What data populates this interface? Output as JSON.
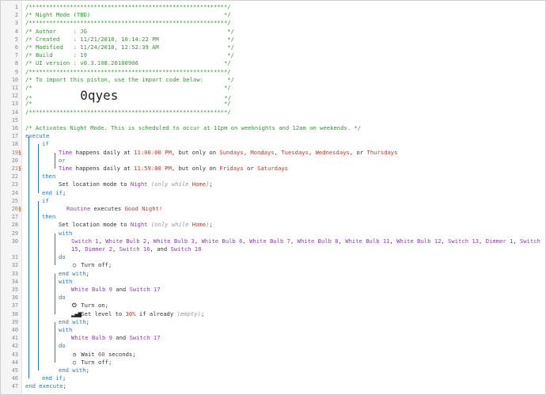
{
  "lines": [
    {
      "n": "1",
      "flag": "",
      "indent": 31,
      "parts": [
        {
          "c": "c",
          "t": "/**********************************************************/"
        }
      ]
    },
    {
      "n": "2",
      "flag": "",
      "indent": 31,
      "parts": [
        {
          "c": "c",
          "t": "/* Night Mode (TBD)                                       */"
        }
      ]
    },
    {
      "n": "3",
      "flag": "",
      "indent": 31,
      "parts": [
        {
          "c": "c",
          "t": "/**********************************************************/"
        }
      ]
    },
    {
      "n": "4",
      "flag": "",
      "indent": 31,
      "parts": [
        {
          "c": "c",
          "t": "/* Author     : JG                                         */"
        }
      ]
    },
    {
      "n": "5",
      "flag": "",
      "indent": 31,
      "parts": [
        {
          "c": "c",
          "t": "/* Created    : 11/21/2018, 10:14:22 PM                    */"
        }
      ]
    },
    {
      "n": "6",
      "flag": "",
      "indent": 31,
      "parts": [
        {
          "c": "c",
          "t": "/* Modified   : 11/24/2018, 12:52:39 AM                    */"
        }
      ]
    },
    {
      "n": "7",
      "flag": "",
      "indent": 31,
      "parts": [
        {
          "c": "c",
          "t": "/* Build      : 19                                         */"
        }
      ]
    },
    {
      "n": "8",
      "flag": "",
      "indent": 31,
      "parts": [
        {
          "c": "c",
          "t": "/* UI version : v0.3.108.20180906                         */"
        }
      ]
    },
    {
      "n": "9",
      "flag": "",
      "indent": 31,
      "parts": [
        {
          "c": "c",
          "t": "/**********************************************************/"
        }
      ]
    },
    {
      "n": "10",
      "flag": "",
      "indent": 31,
      "parts": [
        {
          "c": "c",
          "t": "/* To import this piston, use the import code below:       */"
        }
      ]
    },
    {
      "n": "11",
      "flag": "",
      "indent": 31,
      "parts": [
        {
          "c": "c",
          "t": "/*                                                        */"
        }
      ]
    },
    {
      "n": "12",
      "flag": "",
      "indent": 31,
      "parts": [
        {
          "c": "c",
          "t": "/*              "
        },
        {
          "c": "big",
          "t": "0qyes"
        },
        {
          "c": "c",
          "t": "                               */"
        }
      ]
    },
    {
      "n": "13",
      "flag": "",
      "indent": 31,
      "parts": [
        {
          "c": "c",
          "t": "/*                                                        */"
        }
      ]
    },
    {
      "n": "14",
      "flag": "",
      "indent": 31,
      "parts": [
        {
          "c": "c",
          "t": "/**********************************************************/"
        }
      ]
    },
    {
      "n": "15",
      "flag": "",
      "indent": 31,
      "parts": []
    },
    {
      "n": "16",
      "flag": "",
      "indent": 31,
      "parts": [
        {
          "c": "c",
          "t": "/* Activates Night Mode. This is scheduled to occur at 11pm on weeknights and 12am on weekends. */"
        }
      ]
    },
    {
      "n": "17",
      "flag": "",
      "indent": 31,
      "parts": [
        {
          "c": "k",
          "t": "execute"
        }
      ]
    },
    {
      "n": "18",
      "flag": "",
      "indent": 52,
      "parts": [
        {
          "c": "k",
          "t": "if"
        }
      ]
    },
    {
      "n": "19",
      "flag": "§",
      "indent": 73,
      "parts": [
        {
          "c": "v",
          "t": "Time"
        },
        {
          "c": "t",
          "t": " happens daily at "
        },
        {
          "c": "n",
          "t": "11:00:00 PM"
        },
        {
          "c": "t",
          "t": ", but only on "
        },
        {
          "c": "s",
          "t": "Sundays"
        },
        {
          "c": "t",
          "t": ", "
        },
        {
          "c": "s",
          "t": "Mondays"
        },
        {
          "c": "t",
          "t": ", "
        },
        {
          "c": "s",
          "t": "Tuesdays"
        },
        {
          "c": "t",
          "t": ", "
        },
        {
          "c": "s",
          "t": "Wednesdays"
        },
        {
          "c": "t",
          "t": ", or "
        },
        {
          "c": "s",
          "t": "Thursdays"
        }
      ]
    },
    {
      "n": "20",
      "flag": "",
      "indent": 73,
      "parts": [
        {
          "c": "k",
          "t": "or"
        }
      ]
    },
    {
      "n": "21",
      "flag": "§",
      "indent": 73,
      "parts": [
        {
          "c": "v",
          "t": "Time"
        },
        {
          "c": "t",
          "t": " happens daily at "
        },
        {
          "c": "n",
          "t": "11:59:00 PM"
        },
        {
          "c": "t",
          "t": ", but only on "
        },
        {
          "c": "s",
          "t": "Fridays"
        },
        {
          "c": "t",
          "t": " or "
        },
        {
          "c": "s",
          "t": "Saturdays"
        }
      ]
    },
    {
      "n": "22",
      "flag": "",
      "indent": 52,
      "parts": [
        {
          "c": "k",
          "t": "then"
        }
      ]
    },
    {
      "n": "23",
      "flag": "",
      "indent": 73,
      "parts": [
        {
          "c": "t",
          "t": "Set location mode to "
        },
        {
          "c": "v",
          "t": "Night"
        },
        {
          "c": "t",
          "t": " "
        },
        {
          "c": "m",
          "t": "(only while "
        },
        {
          "c": "s",
          "t": "Home"
        },
        {
          "c": "m",
          "t": ")"
        },
        {
          "c": "t",
          "t": ";"
        }
      ]
    },
    {
      "n": "24",
      "flag": "",
      "indent": 52,
      "parts": [
        {
          "c": "k",
          "t": "end if"
        },
        {
          "c": "t",
          "t": ";"
        }
      ]
    },
    {
      "n": "25",
      "flag": "",
      "indent": 52,
      "parts": [
        {
          "c": "k",
          "t": "if"
        }
      ]
    },
    {
      "n": "26",
      "flag": "§",
      "indent": 83,
      "parts": [
        {
          "c": "v",
          "t": "Routine"
        },
        {
          "c": "t",
          "t": " executes "
        },
        {
          "c": "s",
          "t": "Good Night!"
        }
      ]
    },
    {
      "n": "27",
      "flag": "",
      "indent": 52,
      "parts": [
        {
          "c": "k",
          "t": "then"
        }
      ]
    },
    {
      "n": "28",
      "flag": "",
      "indent": 73,
      "parts": [
        {
          "c": "t",
          "t": "Set location mode to "
        },
        {
          "c": "v",
          "t": "Night"
        },
        {
          "c": "t",
          "t": " "
        },
        {
          "c": "m",
          "t": "(only while "
        },
        {
          "c": "s",
          "t": "Home"
        },
        {
          "c": "m",
          "t": ")"
        },
        {
          "c": "t",
          "t": ";"
        }
      ]
    },
    {
      "n": "29",
      "flag": "",
      "indent": 73,
      "parts": [
        {
          "c": "k",
          "t": "with"
        }
      ]
    },
    {
      "n": "30",
      "flag": "",
      "indent": 89,
      "parts": [
        {
          "c": "v",
          "t": "Switch 1"
        },
        {
          "c": "t",
          "t": ", "
        },
        {
          "c": "v",
          "t": "White Bulb 2"
        },
        {
          "c": "t",
          "t": ", "
        },
        {
          "c": "v",
          "t": "White Bulb 3"
        },
        {
          "c": "t",
          "t": ", "
        },
        {
          "c": "v",
          "t": "White Bulb 6"
        },
        {
          "c": "t",
          "t": ", "
        },
        {
          "c": "v",
          "t": "White Bulb 7"
        },
        {
          "c": "t",
          "t": ", "
        },
        {
          "c": "v",
          "t": "White Bulb 8"
        },
        {
          "c": "t",
          "t": ", "
        },
        {
          "c": "v",
          "t": "White Bulb 11"
        },
        {
          "c": "t",
          "t": ", "
        },
        {
          "c": "v",
          "t": "White Bulb 12"
        },
        {
          "c": "t",
          "t": ", "
        },
        {
          "c": "v",
          "t": "Switch 13"
        },
        {
          "c": "t",
          "t": ", "
        },
        {
          "c": "v",
          "t": "Dimmer 1"
        },
        {
          "c": "t",
          "t": ", "
        },
        {
          "c": "v",
          "t": "Switch"
        }
      ]
    },
    {
      "n": "",
      "flag": "",
      "indent": 89,
      "parts": [
        {
          "c": "v",
          "t": "15"
        },
        {
          "c": "t",
          "t": ", "
        },
        {
          "c": "v",
          "t": "Dimmer 2"
        },
        {
          "c": "t",
          "t": ", "
        },
        {
          "c": "v",
          "t": "Switch 16"
        },
        {
          "c": "t",
          "t": ", and "
        },
        {
          "c": "v",
          "t": "Switch 18"
        }
      ]
    },
    {
      "n": "31",
      "flag": "",
      "indent": 73,
      "parts": [
        {
          "c": "k",
          "t": "do"
        }
      ]
    },
    {
      "n": "32",
      "flag": "",
      "indent": 89,
      "parts": [
        {
          "c": "icon",
          "t": "◯"
        },
        {
          "c": "t",
          "t": " Turn off;"
        }
      ]
    },
    {
      "n": "33",
      "flag": "",
      "indent": 73,
      "parts": [
        {
          "c": "k",
          "t": "end with"
        },
        {
          "c": "t",
          "t": ";"
        }
      ]
    },
    {
      "n": "34",
      "flag": "",
      "indent": 73,
      "parts": [
        {
          "c": "k",
          "t": "with"
        }
      ]
    },
    {
      "n": "35",
      "flag": "",
      "indent": 89,
      "parts": [
        {
          "c": "v",
          "t": "White Bulb 9"
        },
        {
          "c": "t",
          "t": " and "
        },
        {
          "c": "v",
          "t": "Switch 17"
        }
      ]
    },
    {
      "n": "36",
      "flag": "",
      "indent": 73,
      "parts": [
        {
          "c": "k",
          "t": "do"
        }
      ]
    },
    {
      "n": "37",
      "flag": "",
      "indent": 89,
      "parts": [
        {
          "c": "icon",
          "t": "⏻"
        },
        {
          "c": "t",
          "t": " Turn on;"
        }
      ]
    },
    {
      "n": "38",
      "flag": "",
      "indent": 89,
      "parts": [
        {
          "c": "icon",
          "t": "▂▄▆"
        },
        {
          "c": "t",
          "t": " Set level to "
        },
        {
          "c": "n",
          "t": "30%"
        },
        {
          "c": "t",
          "t": " if already "
        },
        {
          "c": "m",
          "t": "(empty)"
        },
        {
          "c": "t",
          "t": ";"
        }
      ]
    },
    {
      "n": "39",
      "flag": "",
      "indent": 73,
      "parts": [
        {
          "c": "k",
          "t": "end with"
        },
        {
          "c": "t",
          "t": ";"
        }
      ]
    },
    {
      "n": "40",
      "flag": "",
      "indent": 73,
      "parts": [
        {
          "c": "k",
          "t": "with"
        }
      ]
    },
    {
      "n": "41",
      "flag": "",
      "indent": 89,
      "parts": [
        {
          "c": "v",
          "t": "White Bulb 9"
        },
        {
          "c": "t",
          "t": " and "
        },
        {
          "c": "v",
          "t": "Switch 17"
        }
      ]
    },
    {
      "n": "42",
      "flag": "",
      "indent": 73,
      "parts": [
        {
          "c": "k",
          "t": "do"
        }
      ]
    },
    {
      "n": "43",
      "flag": "",
      "indent": 89,
      "parts": [
        {
          "c": "icon",
          "t": "◷"
        },
        {
          "c": "t",
          "t": " Wait "
        },
        {
          "c": "n",
          "t": "60"
        },
        {
          "c": "t",
          "t": " seconds;"
        }
      ]
    },
    {
      "n": "44",
      "flag": "",
      "indent": 89,
      "parts": [
        {
          "c": "icon",
          "t": "◯"
        },
        {
          "c": "t",
          "t": " Turn off;"
        }
      ]
    },
    {
      "n": "45",
      "flag": "",
      "indent": 73,
      "parts": [
        {
          "c": "k",
          "t": "end with"
        },
        {
          "c": "t",
          "t": ";"
        }
      ]
    },
    {
      "n": "46",
      "flag": "",
      "indent": 52,
      "parts": [
        {
          "c": "k",
          "t": "end if"
        },
        {
          "c": "t",
          "t": ";"
        }
      ]
    },
    {
      "n": "47",
      "flag": "",
      "indent": 31,
      "parts": [
        {
          "c": "k",
          "t": "end execute"
        },
        {
          "c": "t",
          "t": ";"
        }
      ]
    }
  ]
}
